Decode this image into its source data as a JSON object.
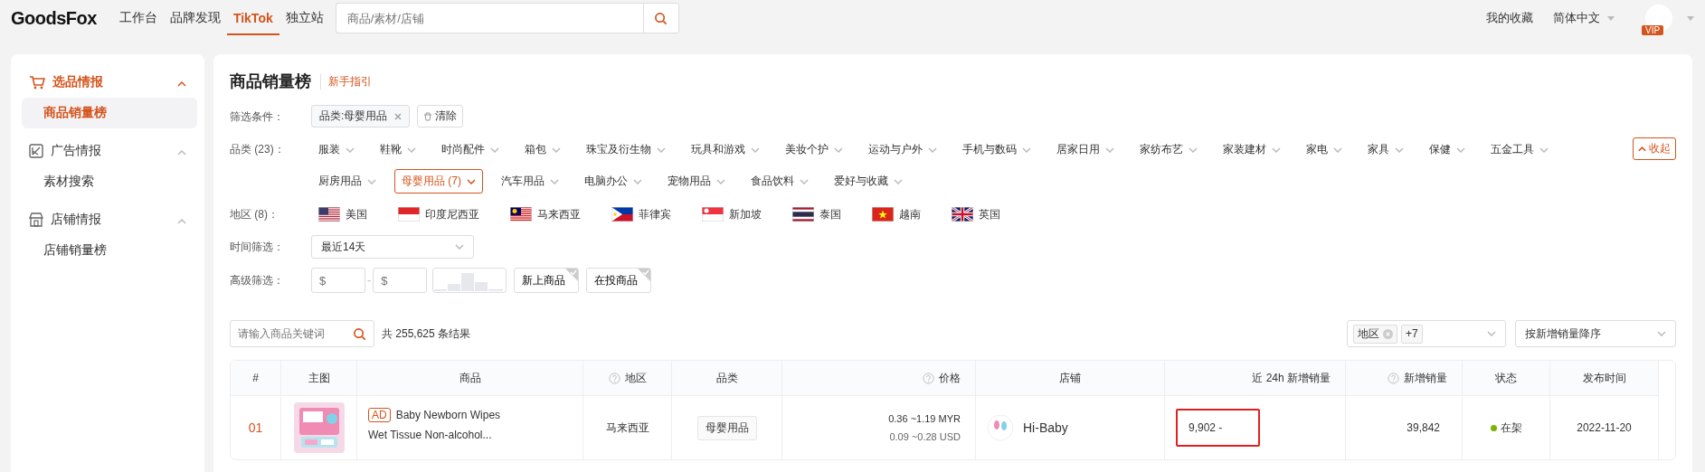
{
  "topbar": {
    "logo": "GoodsFox",
    "nav": [
      {
        "label": "工作台",
        "selected": false
      },
      {
        "label": "品牌发现",
        "selected": false
      },
      {
        "label": "TikTok",
        "selected": true
      },
      {
        "label": "独立站",
        "selected": false
      }
    ],
    "search": {
      "placeholder": "商品/素材/店铺"
    },
    "favorites": "我的收藏",
    "language": "简体中文",
    "vip_badge": "VIP"
  },
  "sidebar": {
    "sections": [
      {
        "title": "选品情报",
        "kind": "cart",
        "active": true,
        "expanded": true,
        "items": [
          {
            "label": "商品销量榜",
            "selected": true
          }
        ]
      },
      {
        "title": "广告情报",
        "kind": "ad",
        "active": false,
        "expanded": true,
        "items": [
          {
            "label": "素材搜索",
            "selected": false
          }
        ]
      },
      {
        "title": "店铺情报",
        "kind": "shop",
        "active": false,
        "expanded": true,
        "items": [
          {
            "label": "店铺销量榜",
            "selected": false
          }
        ]
      }
    ]
  },
  "page": {
    "title": "商品销量榜",
    "guide_link": "新手指引"
  },
  "filters": {
    "conditions_label": "筛选条件：",
    "conditions": [
      {
        "label": "品类:母婴用品"
      }
    ],
    "clear": "清除",
    "category_label": "品类 (23)：",
    "collapse": "收起",
    "categories": [
      {
        "label": "服装",
        "selected": false
      },
      {
        "label": "鞋靴",
        "selected": false
      },
      {
        "label": "时尚配件",
        "selected": false
      },
      {
        "label": "箱包",
        "selected": false
      },
      {
        "label": "珠宝及衍生物",
        "selected": false
      },
      {
        "label": "玩具和游戏",
        "selected": false
      },
      {
        "label": "美妆个护",
        "selected": false
      },
      {
        "label": "运动与户外",
        "selected": false
      },
      {
        "label": "手机与数码",
        "selected": false
      },
      {
        "label": "居家日用",
        "selected": false
      },
      {
        "label": "家纺布艺",
        "selected": false
      },
      {
        "label": "家装建材",
        "selected": false
      },
      {
        "label": "家电",
        "selected": false
      },
      {
        "label": "家具",
        "selected": false
      },
      {
        "label": "保健",
        "selected": false
      },
      {
        "label": "五金工具",
        "selected": false
      },
      {
        "label": "厨房用品",
        "selected": false
      },
      {
        "label": "母婴用品 (7)",
        "selected": true
      },
      {
        "label": "汽车用品",
        "selected": false
      },
      {
        "label": "电脑办公",
        "selected": false
      },
      {
        "label": "宠物用品",
        "selected": false
      },
      {
        "label": "食品饮料",
        "selected": false
      },
      {
        "label": "爱好与收藏",
        "selected": false
      }
    ],
    "region_label": "地区 (8)：",
    "regions": [
      {
        "label": "美国",
        "kind": "us"
      },
      {
        "label": "印度尼西亚",
        "kind": "id"
      },
      {
        "label": "马来西亚",
        "kind": "my"
      },
      {
        "label": "菲律宾",
        "kind": "ph"
      },
      {
        "label": "新加坡",
        "kind": "sg"
      },
      {
        "label": "泰国",
        "kind": "th"
      },
      {
        "label": "越南",
        "kind": "vn"
      },
      {
        "label": "英国",
        "kind": "gb"
      }
    ],
    "time_label": "时间筛选：",
    "time_value": "最近14天",
    "advanced_label": "高级筛选：",
    "price_min": {
      "placeholder": "$"
    },
    "range_separator": "-",
    "price_max": {
      "placeholder": "$"
    },
    "toggles": [
      {
        "label": "新上商品",
        "checked": false
      },
      {
        "label": "在投商品",
        "checked": false
      }
    ]
  },
  "results": {
    "search": {
      "placeholder": "请输入商品关键词"
    },
    "count": "共 255,625 条结果",
    "region_select": {
      "tag": "地区",
      "more": "+7"
    },
    "sort": "按新增销量降序"
  },
  "table": {
    "columns": [
      {
        "label": "#",
        "help": false
      },
      {
        "label": "主图",
        "help": false
      },
      {
        "label": "商品",
        "help": false
      },
      {
        "label": "地区",
        "help": true
      },
      {
        "label": "品类",
        "help": false
      },
      {
        "label": "价格",
        "help": true
      },
      {
        "label": "店铺",
        "help": false
      },
      {
        "label": "近 24h 新增销量",
        "help": false
      },
      {
        "label": "新增销量",
        "help": true
      },
      {
        "label": "状态",
        "help": false
      },
      {
        "label": "发布时间",
        "help": false
      }
    ],
    "rows": [
      {
        "rank": "01",
        "ad": "AD",
        "title_lines": [
          "Baby Newborn Wipes",
          "Wet Tissue Non-alcohol..."
        ],
        "region": "马来西亚",
        "category": "母婴用品",
        "price_lines": [
          "0.36 ~1.19 MYR",
          "0.09 ~0.28 USD"
        ],
        "shop": "Hi-Baby",
        "sales_24h": "9,902 -",
        "highlighted": true,
        "sales": "39,842",
        "status": "在架",
        "color": "#7cb305",
        "date": "2022-11-20"
      }
    ]
  }
}
